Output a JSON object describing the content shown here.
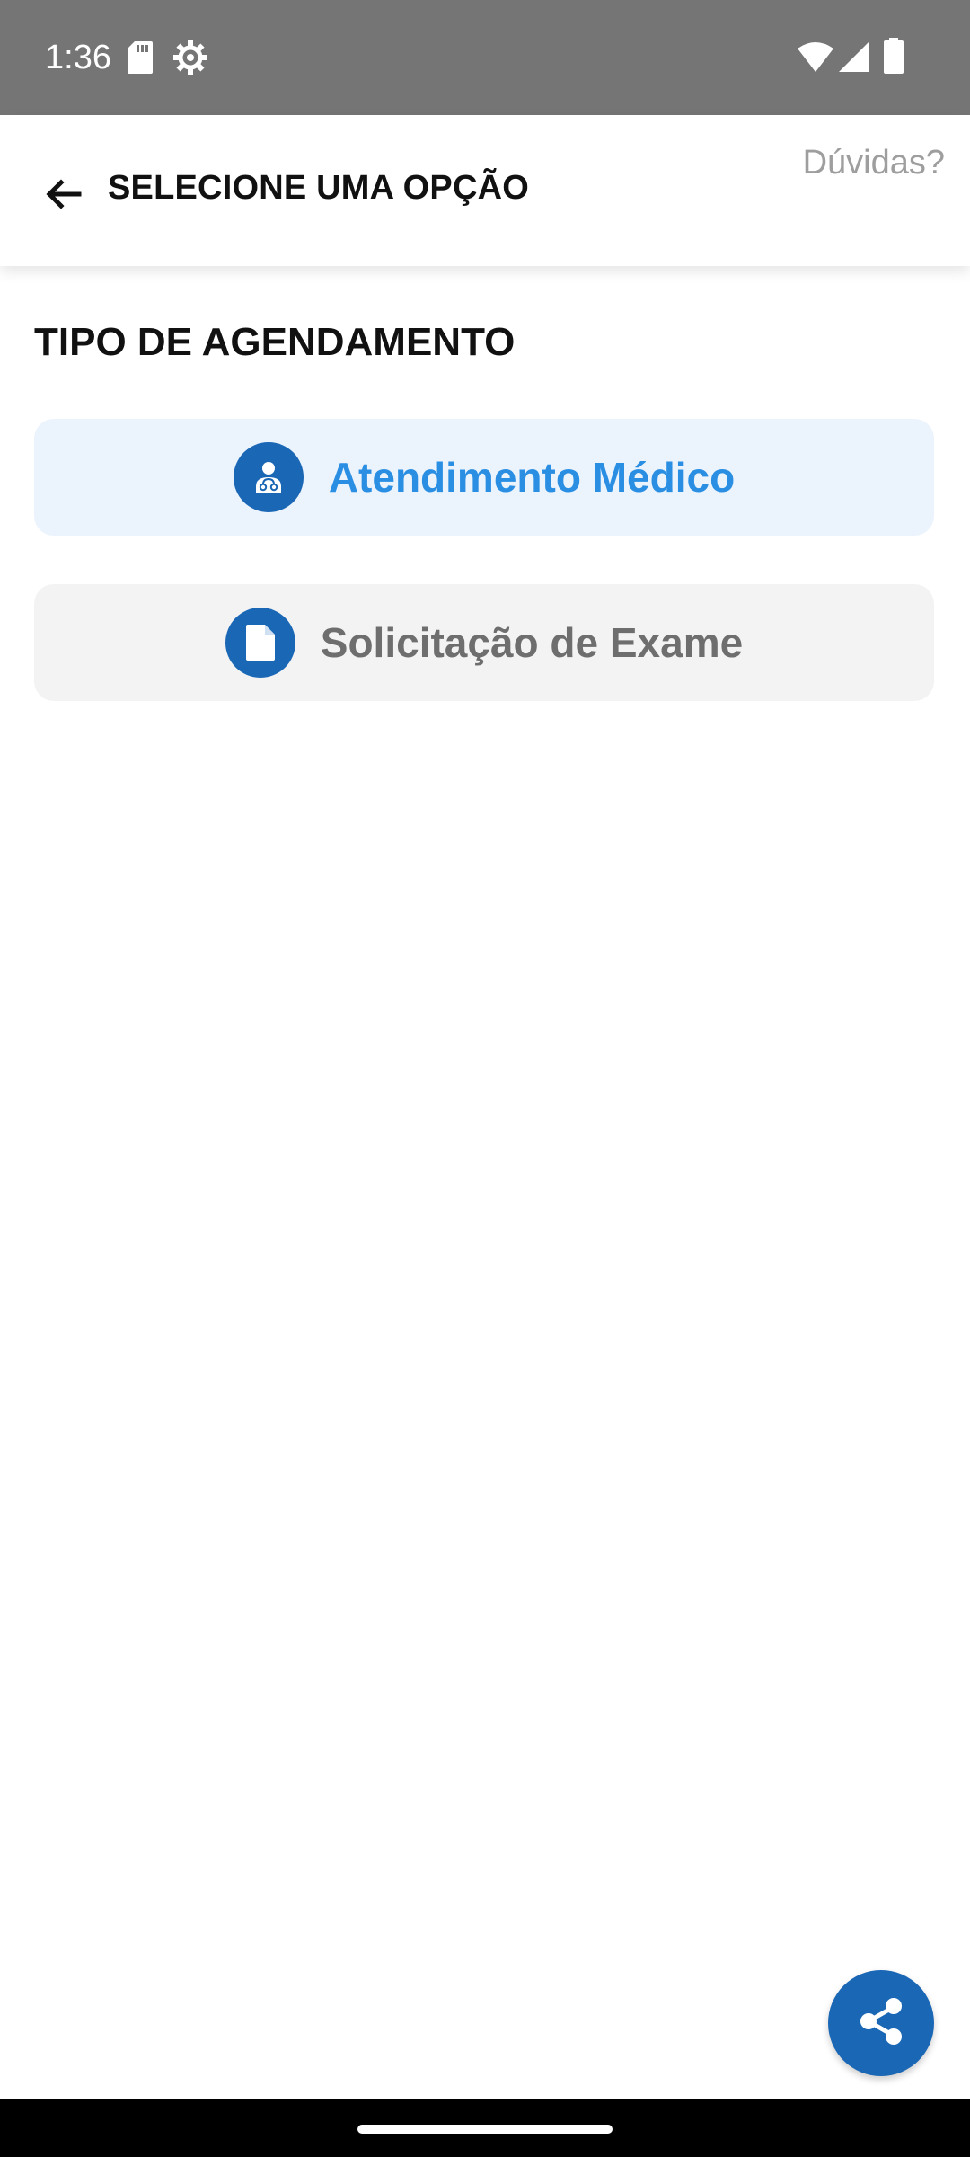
{
  "status_bar": {
    "time": "1:36",
    "icons": [
      "sd-card-icon",
      "settings-gear-icon",
      "wifi-icon",
      "signal-icon",
      "battery-icon"
    ]
  },
  "app_bar": {
    "back_icon": "arrow-back-icon",
    "title": "SELECIONE UMA OPÇÃO",
    "help": "Dúvidas?"
  },
  "section": {
    "title": "TIPO DE AGENDAMENTO"
  },
  "options": [
    {
      "label": "Atendimento Médico",
      "icon": "doctor-icon",
      "selected": true
    },
    {
      "label": "Solicitação de Exame",
      "icon": "document-icon",
      "selected": false
    }
  ],
  "fab": {
    "icon": "share-icon"
  },
  "colors": {
    "status_bar": "#757575",
    "accent": "#1a67b6",
    "selected_text": "#2a8fe3",
    "selected_bg": "#ebf3fd",
    "unselected_bg": "#f3f3f3",
    "unselected_text": "#6e6e6e",
    "help_text": "#9e9e9e"
  }
}
